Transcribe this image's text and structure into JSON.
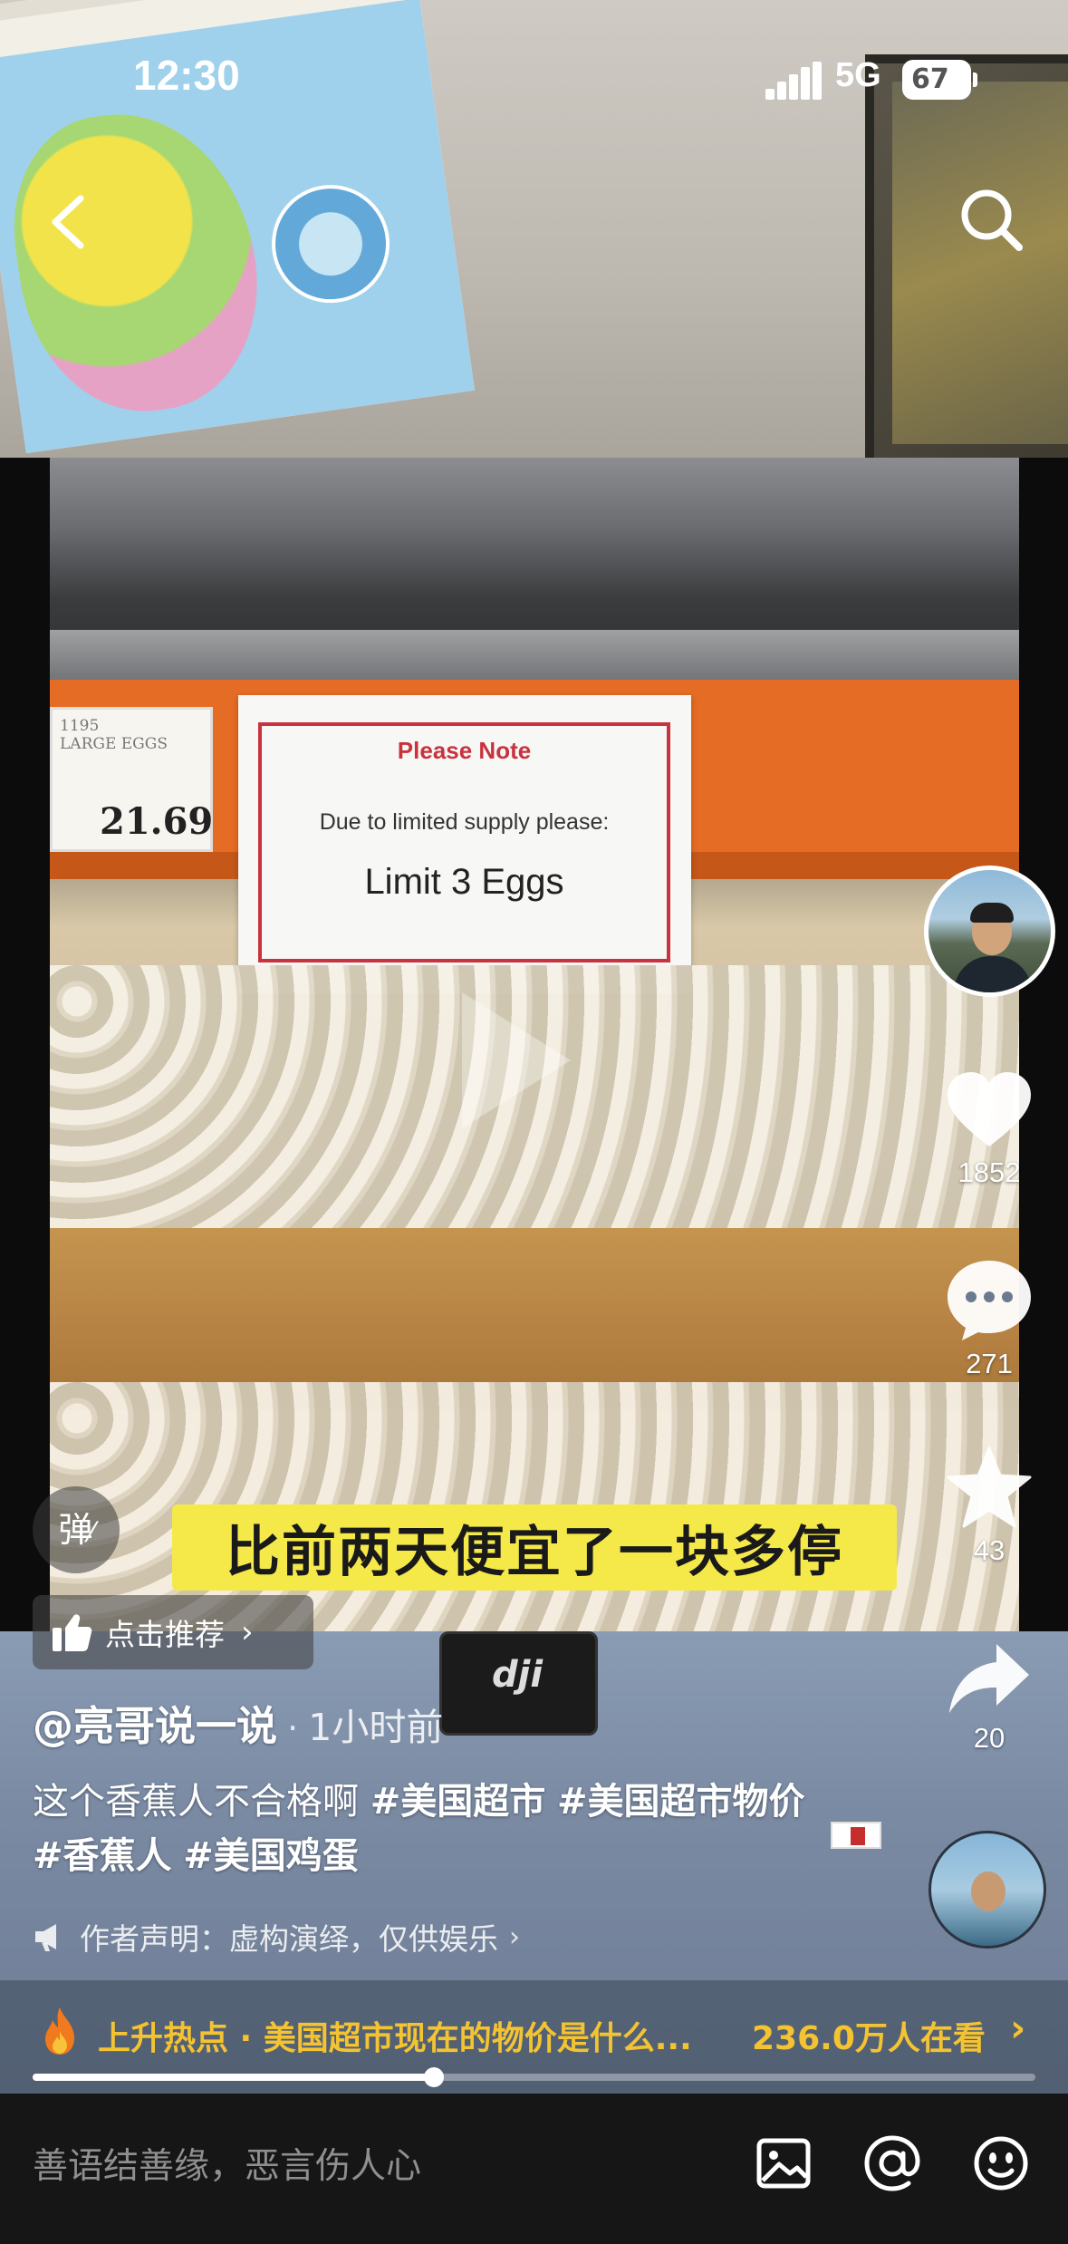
{
  "status": {
    "time": "12:30",
    "network": "5G",
    "battery": "67"
  },
  "video": {
    "price_tag": "21.69",
    "price_tag_small": "1195\nLARGE EGGS",
    "sign_title": "Please Note",
    "sign_line": "Due to limited supply please:",
    "sign_limit": "Limit 3 Eggs",
    "subtitle": "比前两天便宜了一块多停"
  },
  "actions": {
    "likes": "1852",
    "comments": "271",
    "favorites": "43",
    "shares": "20"
  },
  "overlay": {
    "danmaku_label": "弹",
    "recommend_label": "点击推荐",
    "author": "@亮哥说一说",
    "time_ago": "1小时前",
    "caption_text": "这个香蕉人不合格啊 ",
    "tags": [
      "#美国超市",
      "#美国超市物价",
      "#香蕉人",
      "#美国鸡蛋"
    ],
    "disclaimer": "作者声明：虚构演绎，仅供娱乐"
  },
  "hot": {
    "title": "上升热点 · 美国超市现在的物价是什么...",
    "viewers": "236.0万人在看",
    "progress": 0.4
  },
  "input": {
    "placeholder": "善语结善缘，恶言伤人心"
  },
  "colors": {
    "hot_accent": "#f4c332",
    "subtitle_bg": "#f5e94a",
    "sign_red": "#c8333e"
  },
  "icons": [
    "back-icon",
    "search-icon",
    "heart-icon",
    "comment-icon",
    "star-icon",
    "share-icon",
    "thumbs-up-icon",
    "megaphone-icon",
    "flame-icon",
    "image-icon",
    "at-icon",
    "emoji-icon"
  ]
}
